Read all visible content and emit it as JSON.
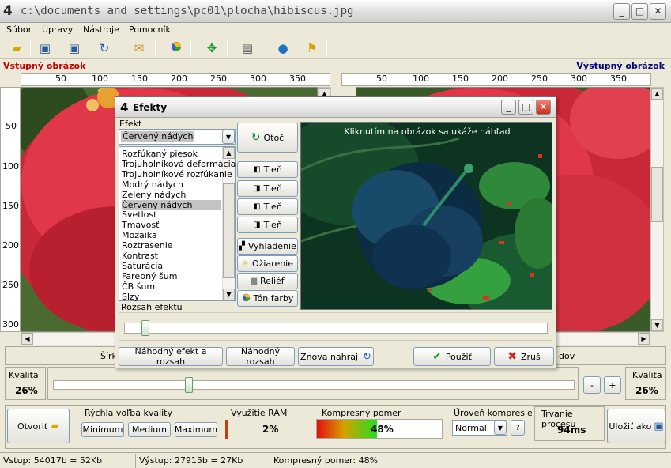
{
  "window": {
    "title": "c:\\documents and settings\\pc01\\plocha\\hibiscus.jpg",
    "buttons": {
      "minimize": "_",
      "maximize": "□",
      "close": "✕"
    }
  },
  "menu": [
    "Súbor",
    "Úpravy",
    "Nástroje",
    "Pomocník"
  ],
  "toolbar_icons": [
    "open-icon",
    "save-icon",
    "save-as-icon",
    "refresh-icon",
    "mail-icon",
    "color-wheel-icon",
    "move-icon",
    "book-icon",
    "globe-icon",
    "signpost-icon"
  ],
  "panels": {
    "input_label": "Vstupný obrázok",
    "output_label": "Výstupný obrázok",
    "input_color": "#cc0000",
    "output_color": "#000080",
    "hruler_ticks": [
      "50",
      "100",
      "150",
      "200",
      "250",
      "300",
      "350"
    ],
    "vruler_ticks": [
      "50",
      "100",
      "150",
      "200",
      "250",
      "300"
    ]
  },
  "infostrip": {
    "left_text": "Šírk",
    "right_text": "dov"
  },
  "quality": {
    "left_label": "Kvalita",
    "left_value": "26%",
    "right_label": "Kvalita",
    "right_value": "26%",
    "slider_fraction": 0.26,
    "minus": "-",
    "plus": "+"
  },
  "bottom": {
    "open_button": "Otvoriť",
    "quick_title": "Rýchla voľba kvality",
    "quick_buttons": [
      "Minimum",
      "Medium",
      "Maximum"
    ],
    "ram_title": "Využitie RAM",
    "ram_value": "2%",
    "ratio_title": "Kompresný pomer",
    "ratio_value": "48%",
    "ratio_fraction": 0.48,
    "level_title": "Úroveň kompresie",
    "level_value": "Normal",
    "duration_title": "Trvanie procesu",
    "duration_value": "94ms",
    "save_button": "Uložiť ako"
  },
  "statusbar": {
    "input": "Vstup: 54017b = 52Kb",
    "output": "Výstup: 27915b = 27Kb",
    "ratio": "Kompresný pomer: 48%"
  },
  "dialog": {
    "title": "Efekty",
    "effect_label": "Efekt",
    "selected_effect": "Červený nádych",
    "effects": [
      "Rozfúkaný piesok",
      "Trojuholníková deformácia",
      "Trojuholníkové rozfúkanie",
      "Modrý nádych",
      "Zelený nádych",
      "Červený nádych",
      "Svetlosť",
      "Tmavosť",
      "Mozaika",
      "Roztrasenie",
      "Kontrast",
      "Saturácia",
      "Farebný šum",
      "ČB šum",
      "Slzy"
    ],
    "selected_index": 5,
    "preview_hint": "Kliknutím na obrázok sa ukáže náhľad",
    "range_label": "Rozsah efektu",
    "range_fraction": 0.05,
    "effect_buttons": [
      "Otoč",
      "Tieň",
      "Tieň",
      "Tieň",
      "Tieň",
      "Vyhladenie",
      "Ožiarenie",
      "Reliéf",
      "Tón farby"
    ],
    "bottom_buttons": [
      "Náhodný efekt a rozsah",
      "Náhodný rozsah",
      "Znova nahraj"
    ],
    "apply": "Použiť",
    "cancel": "Zruš"
  }
}
